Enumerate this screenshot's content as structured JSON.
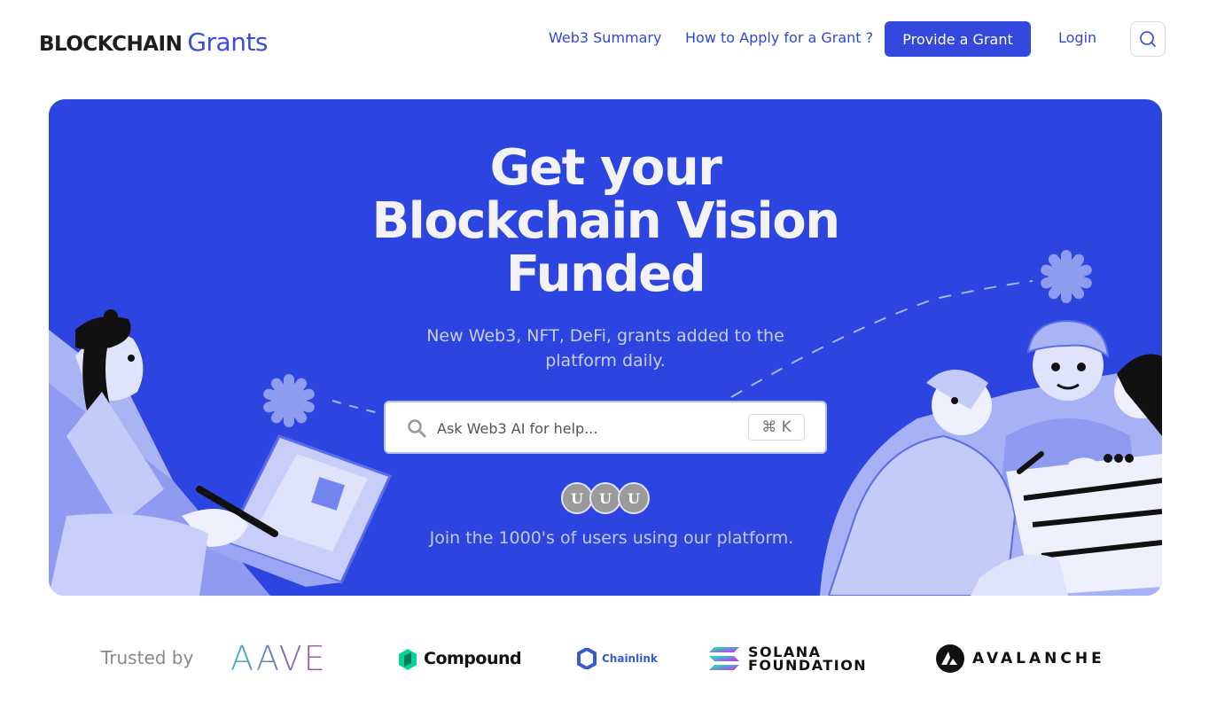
{
  "header": {
    "logo_main": "BLOCKCHAIN",
    "logo_sub": "Grants",
    "nav": {
      "summary_label": "Web3 Summary",
      "apply_label": "How to Apply for a Grant ?"
    },
    "provide_label": "Provide a Grant",
    "login_label": "Login",
    "search_icon": "search-icon"
  },
  "hero": {
    "title_line1": "Get your",
    "title_line2": "Blockchain Vision",
    "title_line3": "Funded",
    "subtitle": "New Web3, NFT, DeFi, grants added to the platform daily.",
    "search": {
      "placeholder": "Ask Web3 AI for help...",
      "shortcut": "⌘ K",
      "icon": "magnifier-icon"
    },
    "avatars": [
      "U",
      "U",
      "U"
    ],
    "join_text": "Join the 1000's of users using our platform."
  },
  "trusted": {
    "label": "Trusted by",
    "partners": {
      "aave": "AAVE",
      "compound": "Compound",
      "chainlink": "Chainlink",
      "solana_line1": "SOLANA",
      "solana_line2": "FOUNDATION",
      "avalanche": "AVALANCHE"
    }
  },
  "colors": {
    "brand_blue": "#3348dd",
    "hero_bg": "#2d45e0",
    "nav_text": "#3046d8"
  }
}
